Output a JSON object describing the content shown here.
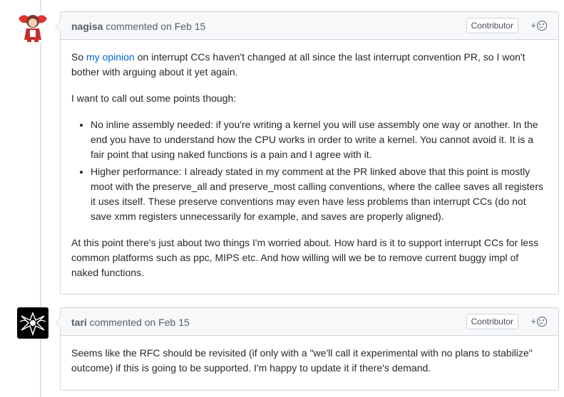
{
  "comments": [
    {
      "author": "nagisa",
      "action": " commented on Feb 15",
      "badge": "Contributor",
      "reaction_plus": "+",
      "body": {
        "p1_pre": "So ",
        "p1_link": "my opinion",
        "p1_post": " on interrupt CCs haven't changed at all since the last interrupt convention PR, so I won't bother with arguing about it yet again.",
        "p2": "I want to call out some points though:",
        "bullets": [
          "No inline assembly needed: if you're writing a kernel you will use assembly one way or another. In the end you have to understand how the CPU works in order to write a kernel. You cannot avoid it. It is a fair point that using naked functions is a pain and I agree with it.",
          "Higher performance: I already stated in my comment at the PR linked above that this point is mostly moot with the preserve_all and preserve_most calling conventions, where the callee saves all registers it uses itself. These preserve conventions may even have less problems than interrupt CCs (do not save xmm registers unnecessarily for example, and saves are properly aligned)."
        ],
        "p3": "At this point there's just about two things I'm worried about. How hard is it to support interrupt CCs for less common platforms such as ppc, MIPS etc. And how willing will we be to remove current buggy impl of naked functions."
      }
    },
    {
      "author": "tari",
      "action": " commented on Feb 15",
      "badge": "Contributor",
      "reaction_plus": "+",
      "body": {
        "p1": "Seems like the RFC should be revisited (if only with a \"we'll call it experimental with no plans to stabilize\" outcome) if this is going to be supported. I'm happy to update it if there's demand."
      }
    }
  ],
  "colors": {
    "link": "#0366d6",
    "header_bg": "#f6f8fa",
    "border": "#d1d5da"
  }
}
